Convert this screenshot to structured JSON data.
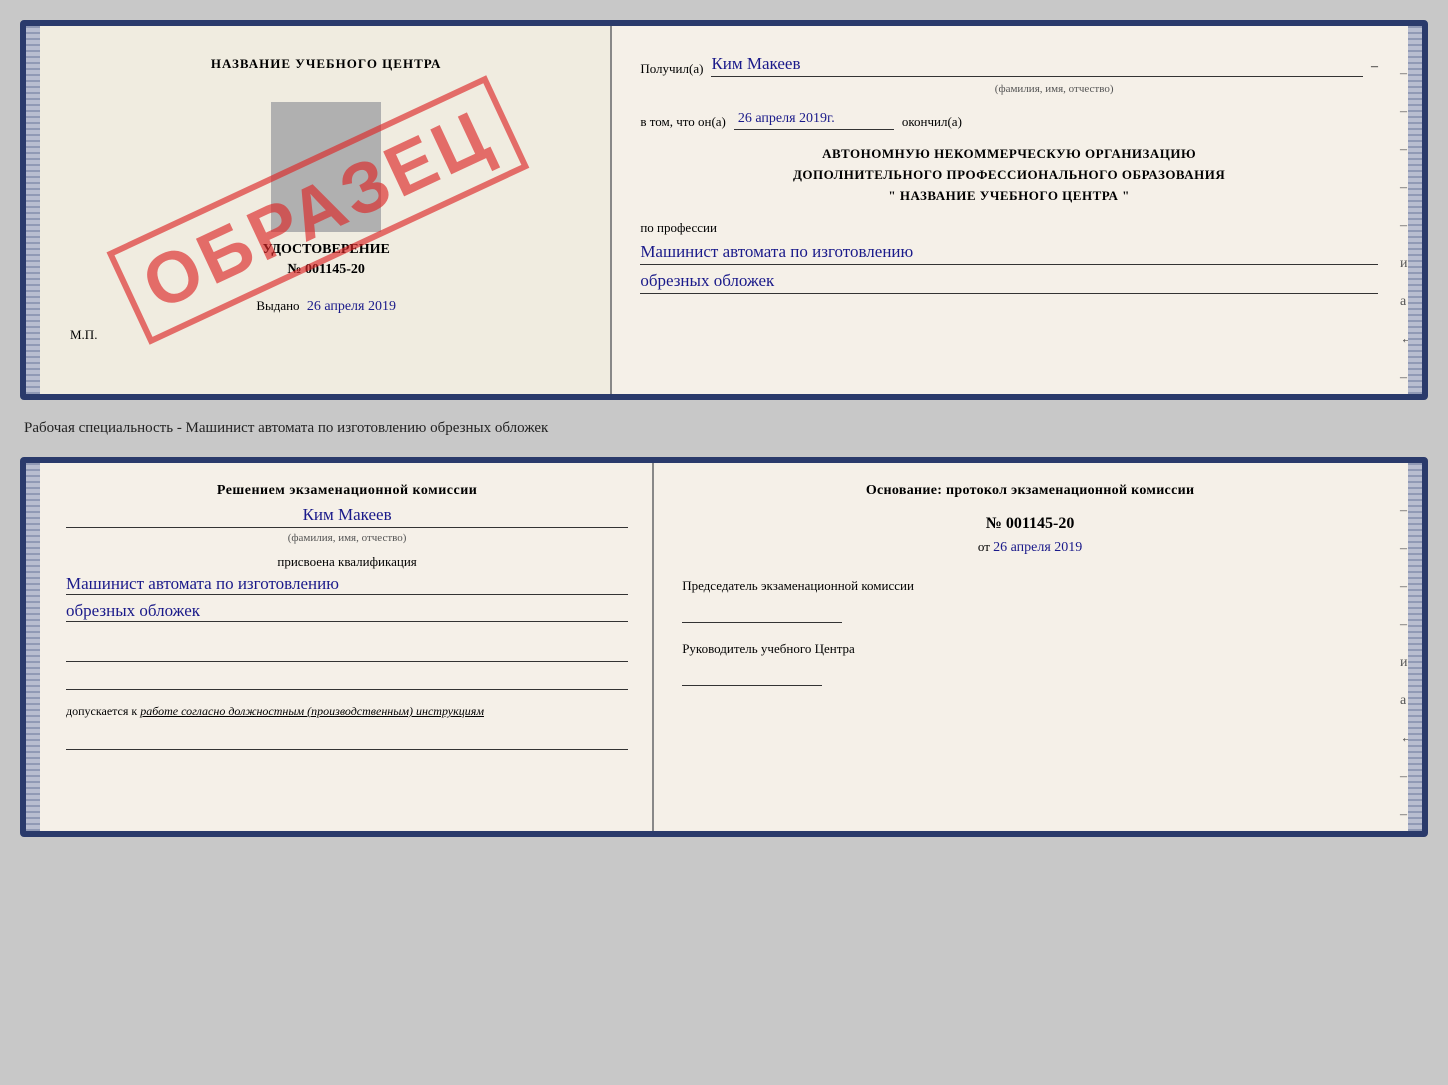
{
  "top_card": {
    "left": {
      "school_name": "НАЗВАНИЕ УЧЕБНОГО ЦЕНТРА",
      "stamp_text": "ОБРАЗЕЦ",
      "udostoverenie_label": "УДОСТОВЕРЕНИЕ",
      "number": "№ 001145-20",
      "vydano_label": "Выдано",
      "vydano_date": "26 апреля 2019",
      "mp_label": "М.П."
    },
    "right": {
      "poluchil_label": "Получил(а)",
      "recipient_name": "Ким Макеев",
      "fio_hint": "(фамилия, имя, отчество)",
      "vtom_label": "в том, что он(а)",
      "date_value": "26 апреля 2019г.",
      "okonchil_label": "окончил(а)",
      "org_line1": "АВТОНОМНУЮ НЕКОММЕРЧЕСКУЮ ОРГАНИЗАЦИЮ",
      "org_line2": "ДОПОЛНИТЕЛЬНОГО ПРОФЕССИОНАЛЬНОГО ОБРАЗОВАНИЯ",
      "org_line3": "\"   НАЗВАНИЕ УЧЕБНОГО ЦЕНТРА   \"",
      "profession_label": "по профессии",
      "profession_line1": "Машинист автомата по изготовлению",
      "profession_line2": "обрезных обложек",
      "dashes": [
        "-",
        "-",
        "-",
        "-",
        "-",
        "и",
        "а",
        "←",
        "-",
        "-",
        "-",
        "-"
      ]
    }
  },
  "caption": {
    "text": "Рабочая специальность - Машинист автомата по изготовлению обрезных обложек"
  },
  "bottom_card": {
    "left": {
      "resheniem_text": "Решением экзаменационной комиссии",
      "name_value": "Ким Макеев",
      "fio_hint": "(фамилия, имя, отчество)",
      "prisvoyena_label": "присвоена квалификация",
      "kval_line1": "Машинист автомата по изготовлению",
      "kval_line2": "обрезных обложек",
      "dopuskaetsya_prefix": "допускается к",
      "dopuskaetsya_link": "работе согласно должностным (производственным) инструкциям"
    },
    "right": {
      "osnovanie_title": "Основание: протокол экзаменационной комиссии",
      "protocol_number": "№  001145-20",
      "ot_label": "от",
      "ot_date": "26 апреля 2019",
      "predsedatel_label": "Председатель экзаменационной комиссии",
      "rukovoditel_label": "Руководитель учебного Центра",
      "dashes": [
        "-",
        "-",
        "-",
        "-",
        "и",
        "а",
        "←",
        "-",
        "-",
        "-",
        "-"
      ]
    }
  }
}
